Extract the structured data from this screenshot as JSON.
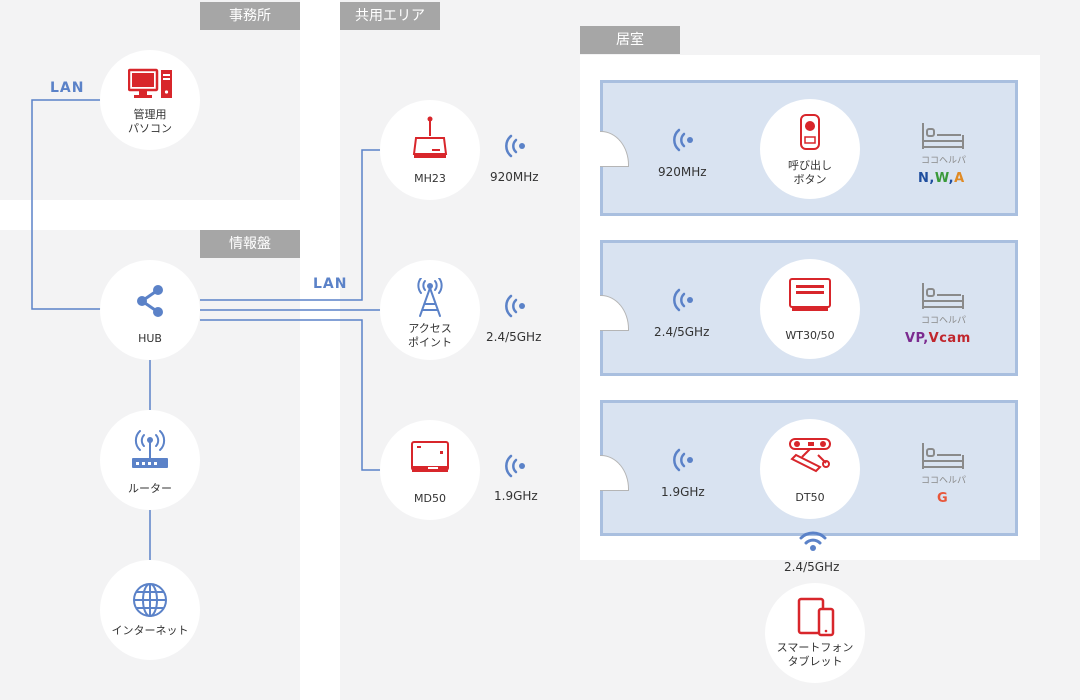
{
  "zones": {
    "office": "事務所",
    "common": "共用エリア",
    "panel": "情報盤",
    "room": "居室"
  },
  "lan_left": "LAN",
  "lan_mid": "LAN",
  "devices": {
    "pc": [
      "管理用",
      "パソコン"
    ],
    "hub": "HUB",
    "router": "ルーター",
    "internet": "インターネット",
    "mh23": "MH23",
    "ap": [
      "アクセス",
      "ポイント"
    ],
    "md50": "MD50",
    "call_button": [
      "呼び出し",
      "ボタン"
    ],
    "wt": "WT30/50",
    "dt50": "DT50",
    "smartphone": [
      "スマートフォン",
      "タブレット"
    ]
  },
  "freqs": {
    "mh23": "920MHz",
    "ap": "2.4/5GHz",
    "md50": "1.9GHz",
    "room1": "920MHz",
    "room2": "2.4/5GHz",
    "room3": "1.9GHz",
    "wifi": "2.4/5GHz"
  },
  "bed_label": "ココヘルパ",
  "codes": {
    "room1": [
      {
        "t": "N",
        "c": "#1f4e9e"
      },
      {
        "t": ",",
        "c": "#1f4e9e"
      },
      {
        "t": "W",
        "c": "#3a9a3a"
      },
      {
        "t": ",",
        "c": "#1f4e9e"
      },
      {
        "t": "A",
        "c": "#e08a24"
      }
    ],
    "room2": [
      {
        "t": "VP",
        "c": "#7b2a8f"
      },
      {
        "t": ",",
        "c": "#7b2a8f"
      },
      {
        "t": "Vcam",
        "c": "#c0262d"
      }
    ],
    "room3": [
      {
        "t": "G",
        "c": "#e8563a"
      }
    ]
  },
  "colors": {
    "device_red": "#d8262b",
    "line_blue": "#5b82c8",
    "room_fill": "#d9e3f1",
    "room_border": "#a9bfdf",
    "zone_bg": "#f3f3f4",
    "tag_bg": "#a6a6a6"
  }
}
